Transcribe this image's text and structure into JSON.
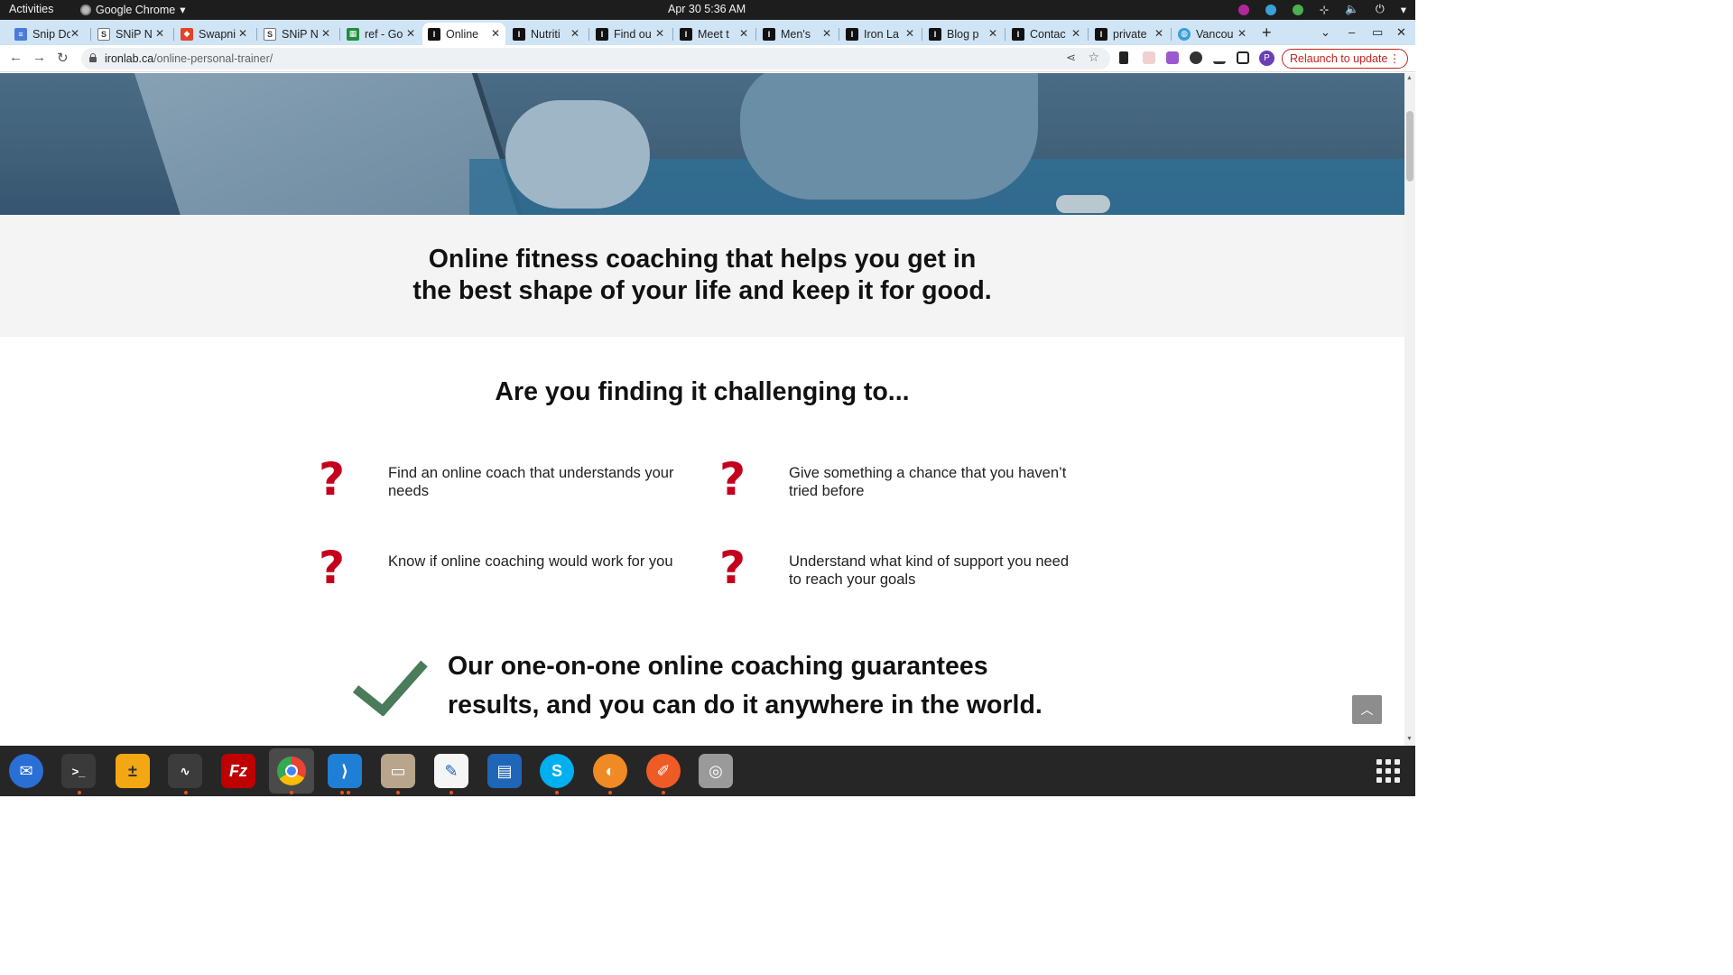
{
  "system_bar": {
    "activities": "Activities",
    "app_name": "Google Chrome",
    "clock": "Apr 30  5:36 AM"
  },
  "tabs": [
    {
      "label": "Snip Do",
      "icon": "docs-icon",
      "color": "#4a7bd8"
    },
    {
      "label": "SNiP N",
      "icon": "snip-icon",
      "color": "#555555"
    },
    {
      "label": "Swapni",
      "icon": "gitlab-icon",
      "color": "#e24329"
    },
    {
      "label": "SNiP N",
      "icon": "snip-icon",
      "color": "#555555"
    },
    {
      "label": "ref - Go",
      "icon": "sheets-icon",
      "color": "#1e8e3e"
    },
    {
      "label": "Online",
      "icon": "ironlab-icon",
      "color": "#111111",
      "active": true
    },
    {
      "label": "Nutriti",
      "icon": "ironlab-icon",
      "color": "#111111"
    },
    {
      "label": "Find ou",
      "icon": "ironlab-icon",
      "color": "#111111"
    },
    {
      "label": "Meet t",
      "icon": "ironlab-icon",
      "color": "#111111"
    },
    {
      "label": "Men's",
      "icon": "ironlab-icon",
      "color": "#111111"
    },
    {
      "label": "Iron La",
      "icon": "ironlab-icon",
      "color": "#111111"
    },
    {
      "label": "Blog p",
      "icon": "ironlab-icon",
      "color": "#111111"
    },
    {
      "label": "Contac",
      "icon": "ironlab-icon",
      "color": "#111111"
    },
    {
      "label": "private",
      "icon": "ironlab-icon",
      "color": "#111111"
    },
    {
      "label": "Vancou",
      "icon": "globe-icon",
      "color": "#3aa0d8"
    }
  ],
  "toolbar": {
    "url_domain": "ironlab.ca",
    "url_path": "/online-personal-trainer/",
    "profile_initial": "P",
    "relaunch_label": "Relaunch to update"
  },
  "page": {
    "headline_line1": "Online fitness coaching that helps you get in",
    "headline_line2": "the best shape of your life and keep it for good.",
    "challenge_title": "Are you finding it challenging to...",
    "challenges": [
      "Find an online coach that understands your needs",
      "Give something a chance that you haven’t tried before",
      "Know if online coaching would work for you",
      "Understand what kind of support you need to reach your goals"
    ],
    "question_mark": "?",
    "guarantee_line1": "Our one-on-one online coaching guarantees",
    "guarantee_line2": "results, and you can do it anywhere in the world.",
    "accent_color": "#c4001d",
    "check_color": "#4a7c59"
  },
  "dock": [
    {
      "name": "thunderbird-icon",
      "color": "#2a6fd6"
    },
    {
      "name": "terminal-icon",
      "color": "#3a3a3a"
    },
    {
      "name": "calculator-icon",
      "color": "#f3a712"
    },
    {
      "name": "system-monitor-icon",
      "color": "#3c3c3c"
    },
    {
      "name": "filezilla-icon",
      "color": "#bf0000"
    },
    {
      "name": "chrome-icon",
      "color": "#4285f4"
    },
    {
      "name": "vscode-icon",
      "color": "#1f7fd4"
    },
    {
      "name": "files-icon",
      "color": "#b8a58c"
    },
    {
      "name": "text-editor-icon",
      "color": "#f5f5f5"
    },
    {
      "name": "writer-icon",
      "color": "#1f65b8"
    },
    {
      "name": "skype-icon",
      "color": "#00aff0"
    },
    {
      "name": "blender-icon",
      "color": "#f08a24"
    },
    {
      "name": "postman-icon",
      "color": "#ef5b25"
    },
    {
      "name": "disk-icon",
      "color": "#9a9a9a"
    }
  ]
}
